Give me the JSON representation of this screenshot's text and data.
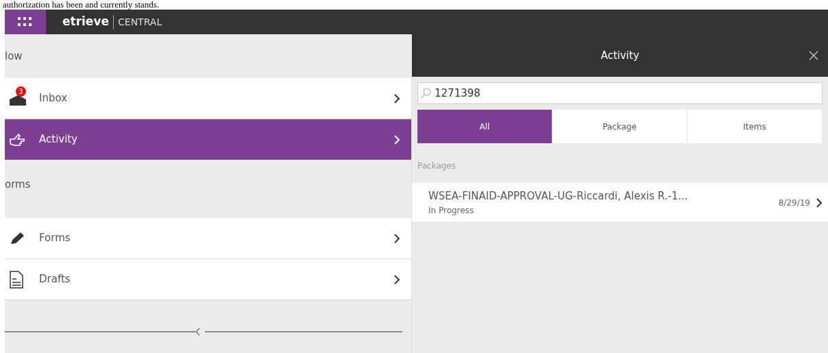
{
  "document_text": "authorization has been and currently stands.",
  "app_header": {
    "brand": "etrieve",
    "product": "CENTRAL"
  },
  "sidebar": {
    "sections": [
      {
        "title": "low",
        "items": [
          {
            "label": "Inbox",
            "kind": "inbox",
            "badge": "3",
            "selected": false
          },
          {
            "label": "Activity",
            "kind": "activity",
            "selected": true
          }
        ]
      },
      {
        "title": "orms",
        "items": [
          {
            "label": "Forms",
            "kind": "forms",
            "selected": false
          },
          {
            "label": "Drafts",
            "kind": "drafts",
            "selected": false
          }
        ]
      }
    ]
  },
  "panel": {
    "title": "Activity",
    "search": {
      "value": "1271398"
    },
    "tabs": [
      {
        "label": "All",
        "selected": true
      },
      {
        "label": "Package",
        "selected": false
      },
      {
        "label": "Items",
        "selected": false
      }
    ],
    "section_title": "Packages",
    "results": [
      {
        "title": "WSEA-FINAID-APPROVAL-UG-Riccardi, Alexis R.-1...",
        "date": "8/29/19",
        "status": "In Progress"
      }
    ]
  }
}
